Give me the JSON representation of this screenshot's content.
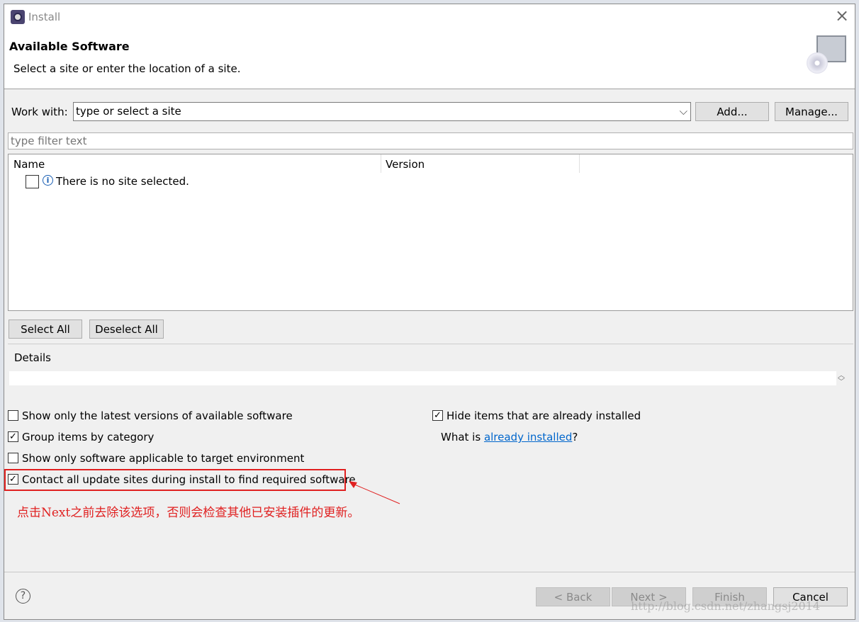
{
  "window": {
    "title": "Install",
    "close": "×"
  },
  "header": {
    "title": "Available Software",
    "subtitle": "Select a site or enter the location of a site."
  },
  "work_with": {
    "label": "Work with:",
    "value": "type or select a site",
    "add": "Add...",
    "manage": "Manage..."
  },
  "filter": {
    "placeholder": "type filter text"
  },
  "table": {
    "columns": [
      "Name",
      "Version"
    ],
    "rows": [
      {
        "text": "There is no site selected.",
        "checked": false
      }
    ]
  },
  "select_all": "Select All",
  "deselect_all": "Deselect All",
  "details": {
    "label": "Details"
  },
  "options": {
    "latest": {
      "label": "Show only the latest versions of available software",
      "checked": false
    },
    "group": {
      "label": "Group items by category",
      "checked": true
    },
    "target": {
      "label": "Show only software applicable to target environment",
      "checked": false
    },
    "contact": {
      "label": "Contact all update sites during install to find required software",
      "checked": true
    },
    "hide": {
      "label": "Hide items that are already installed",
      "checked": true
    },
    "what_is": "What is ",
    "already_link": "already installed",
    "q": "?"
  },
  "annotation": {
    "text": "点击Next之前去除该选项，否则会检查其他已安装插件的更新。",
    "color": "#e02020"
  },
  "footer": {
    "back": "< Back",
    "next": "Next >",
    "finish": "Finish",
    "cancel": "Cancel",
    "help": "?"
  },
  "watermark": "http://blog.csdn.net/zhangsj2014"
}
